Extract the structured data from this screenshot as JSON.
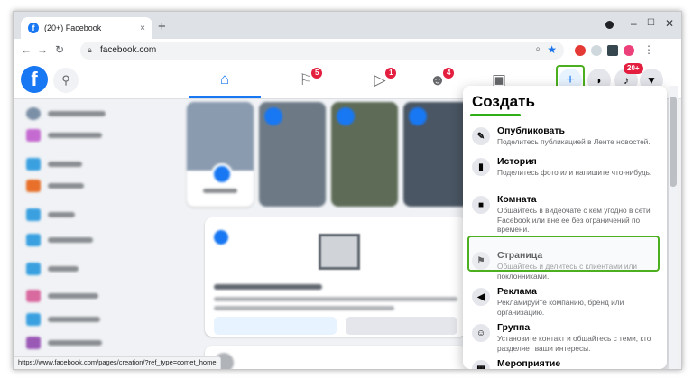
{
  "browser": {
    "tab_title": "(20+) Facebook",
    "tab_close": "×",
    "new_tab": "+",
    "url": "facebook.com",
    "min": "–",
    "max": "☐",
    "close": "✕",
    "status_url": "https://www.facebook.com/pages/creation/?ref_type=comet_home"
  },
  "fb": {
    "logo": "f",
    "badges": {
      "pages": "5",
      "watch": "1",
      "groups": "4",
      "notifications": "20+"
    },
    "create_label": "+"
  },
  "menu": {
    "title": "Создать",
    "items": [
      {
        "title": "Опубликовать",
        "desc": "Поделитесь публикацией в Ленте новостей.",
        "icon": "edit-icon",
        "glyph": "✎"
      },
      {
        "title": "История",
        "desc": "Поделитесь фото или напишите что-нибудь.",
        "icon": "book-icon",
        "glyph": "▮"
      },
      {
        "title": "Комната",
        "desc": "Общайтесь в видеочате с кем угодно в сети Facebook или вне ее без ограничений по времени.",
        "icon": "video-icon",
        "glyph": "■"
      },
      {
        "title": "Страница",
        "desc": "Общайтесь и делитесь с клиентами или поклонниками.",
        "icon": "flag-icon",
        "glyph": "⚑"
      },
      {
        "title": "Реклама",
        "desc": "Рекламируйте компанию, бренд или организацию.",
        "icon": "megaphone-icon",
        "glyph": "◀"
      },
      {
        "title": "Группа",
        "desc": "Установите контакт и общайтесь с теми, кто разделяет ваши интересы.",
        "icon": "group-icon",
        "glyph": "☺"
      },
      {
        "title": "Мероприятие",
        "desc": "",
        "icon": "calendar-icon",
        "glyph": "▦"
      }
    ]
  },
  "colors": {
    "fb_blue": "#1877f2",
    "highlight_green": "#4caf1f",
    "badge_red": "#e41e3f"
  }
}
